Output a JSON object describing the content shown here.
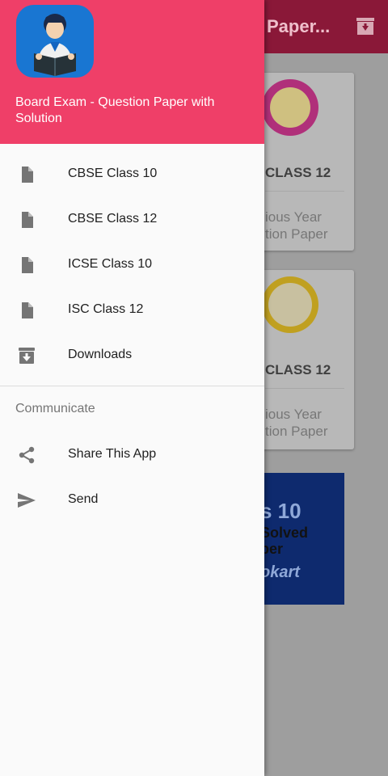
{
  "app_bar": {
    "title": "Paper..."
  },
  "background_cards": [
    {
      "title": "CLASS 12",
      "subtitle_line1": "ious Year",
      "subtitle_line2": "tion Paper"
    },
    {
      "title": "CLASS 12",
      "subtitle_line1": "ious Year",
      "subtitle_line2": "tion Paper"
    }
  ],
  "banner": {
    "line1": "s 10",
    "line2": "Solved",
    "line3": "per",
    "brand": "okart"
  },
  "drawer": {
    "header": {
      "title": "Board Exam - Question Paper with Solution"
    },
    "items": [
      {
        "label": "CBSE Class 10",
        "icon": "document-icon"
      },
      {
        "label": "CBSE Class 12",
        "icon": "document-icon"
      },
      {
        "label": "ICSE Class 10",
        "icon": "document-icon"
      },
      {
        "label": "ISC Class 12",
        "icon": "document-icon"
      },
      {
        "label": "Downloads",
        "icon": "download-box-icon"
      }
    ],
    "communicate": {
      "title": "Communicate",
      "items": [
        {
          "label": "Share This App",
          "icon": "share-icon"
        },
        {
          "label": "Send",
          "icon": "send-icon"
        }
      ]
    }
  },
  "colors": {
    "header": "#ef3f68",
    "app_bar_dimmed": "#8a1838",
    "icon_gray": "#757575"
  }
}
